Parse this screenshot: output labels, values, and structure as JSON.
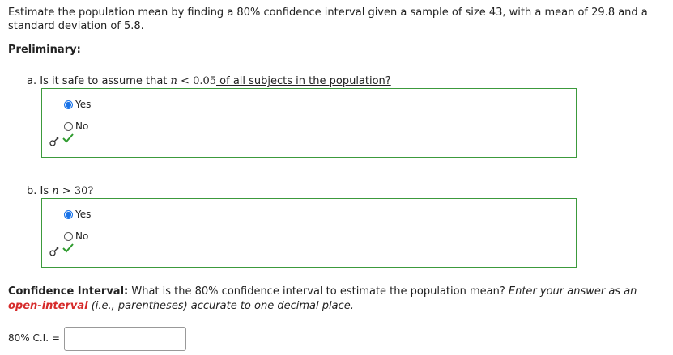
{
  "prompt": "Estimate the population mean by finding a 80% confidence interval given a sample of size 43, with a mean of 29.8 and a standard deviation of 5.8.",
  "preliminary_label": "Preliminary:",
  "question_a": {
    "prefix": "a. Is it safe to assume that ",
    "var": "n",
    "op": " < ",
    "num": "0.05",
    "suffix": " of all subjects in the population?",
    "options": [
      {
        "label": "Yes",
        "selected": true
      },
      {
        "label": "No",
        "selected": false
      }
    ],
    "key_icon": "key-icon",
    "result_icon": "checkmark-icon"
  },
  "question_b": {
    "prefix": "b. Is ",
    "var": "n",
    "op": " > ",
    "num": "30?",
    "options": [
      {
        "label": "Yes",
        "selected": true
      },
      {
        "label": "No",
        "selected": false
      }
    ],
    "key_icon": "key-icon",
    "result_icon": "checkmark-icon"
  },
  "ci": {
    "heading": "Confidence Interval:",
    "question": " What is the 80% confidence interval to estimate the population mean? ",
    "instr1": "Enter your answer as an ",
    "highlight": "open-interval",
    "instr2": " (i.e., parentheses) accurate to one decimal place.",
    "label": "80% C.I. =",
    "value": ""
  },
  "colors": {
    "accent": "#1a73e8",
    "correct": "#2e9b2e",
    "box_border": "#3c9a3c",
    "highlight": "#d62b2b"
  }
}
